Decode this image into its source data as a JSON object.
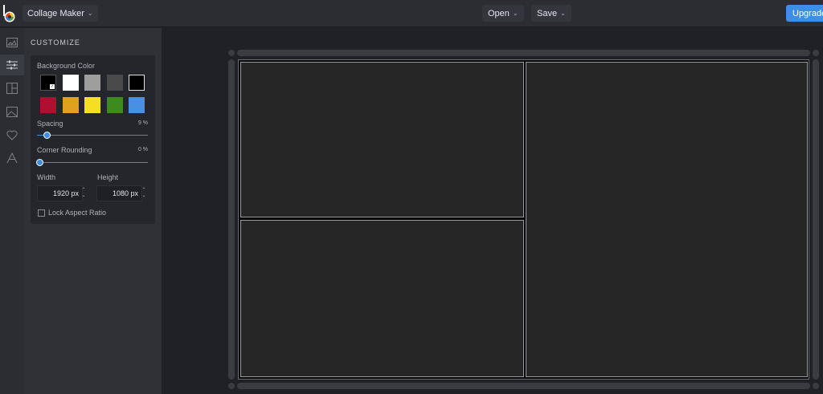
{
  "topbar": {
    "app_menu_label": "Collage Maker",
    "open_label": "Open",
    "save_label": "Save",
    "upgrade_label": "Upgrade"
  },
  "rail": {
    "items": [
      "image-icon",
      "sliders-icon",
      "layout-icon",
      "photo-icon",
      "heart-icon",
      "text-icon"
    ],
    "active": "sliders-icon"
  },
  "panel": {
    "title": "CUSTOMIZE",
    "background_color_label": "Background Color",
    "swatches_row1": [
      "#000000",
      "#ffffff",
      "#9e9e9e",
      "#4a4a4a",
      "#000000"
    ],
    "swatches_row2": [
      "#b0102f",
      "#e0a020",
      "#f4e01e",
      "#3f8a1e",
      "#4a90e2"
    ],
    "selected_swatch": "#000000",
    "spacing_label": "Spacing",
    "spacing_value": "9 %",
    "spacing_level": 0.09,
    "corner_label": "Corner Rounding",
    "corner_value": "0 %",
    "corner_level": 0,
    "width_label": "Width",
    "height_label": "Height",
    "width_value": "1920 px",
    "height_value": "1080 px",
    "lock_label": "Lock Aspect Ratio",
    "lock_checked": false
  },
  "colors": {
    "accent": "#3d8fe3",
    "panel_bg": "#2f3137",
    "canvas_bg": "#1f2126"
  }
}
